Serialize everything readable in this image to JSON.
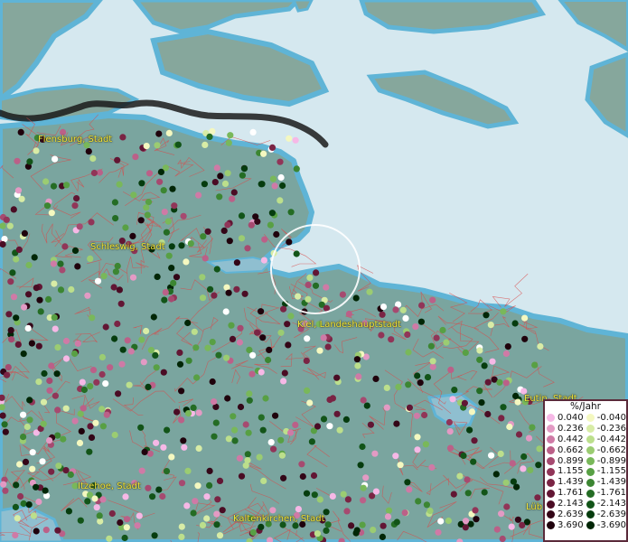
{
  "map": {
    "place_labels": [
      {
        "text": "Flensburg, Stadt"
      },
      {
        "text": "Schleswig, Stadt"
      },
      {
        "text": "Kiel, Landeshauptstadt"
      },
      {
        "text": "Eutin, Stadt"
      },
      {
        "text": "Itzehoe, Stadt"
      },
      {
        "text": "Kaltenkirchen, Stadt"
      },
      {
        "text": "Lüb"
      }
    ]
  },
  "legend": {
    "title": "%/Jahr",
    "positive": [
      {
        "label": "0.040",
        "color": "#f6b8e6"
      },
      {
        "label": "0.236",
        "color": "#e39ac4"
      },
      {
        "label": "0.442",
        "color": "#cf7aa6"
      },
      {
        "label": "0.662",
        "color": "#bb6088"
      },
      {
        "label": "0.899",
        "color": "#a64a70"
      },
      {
        "label": "1.155",
        "color": "#913558"
      },
      {
        "label": "1.439",
        "color": "#7a2444"
      },
      {
        "label": "1.761",
        "color": "#621634"
      },
      {
        "label": "2.143",
        "color": "#4a0c24"
      },
      {
        "label": "2.639",
        "color": "#330617"
      },
      {
        "label": "3.690",
        "color": "#1f020c"
      }
    ],
    "negative": [
      {
        "label": "-0.040",
        "color": "#f4f8c0"
      },
      {
        "label": "-0.236",
        "color": "#d8eca6"
      },
      {
        "label": "-0.442",
        "color": "#bcdf8c"
      },
      {
        "label": "-0.662",
        "color": "#9bcc72"
      },
      {
        "label": "-0.899",
        "color": "#79b85a"
      },
      {
        "label": "-1.155",
        "color": "#58a044"
      },
      {
        "label": "-1.439",
        "color": "#3c8632"
      },
      {
        "label": "-1.761",
        "color": "#246c24"
      },
      {
        "label": "-2.143",
        "color": "#125418"
      },
      {
        "label": "-2.639",
        "color": "#063c0e"
      },
      {
        "label": "-3.690",
        "color": "#012606"
      }
    ]
  },
  "colors": {
    "land": "#7aa59f",
    "sea": "#d5e8ef",
    "coast": "#5fb4d6",
    "boundary": "#d94a4a",
    "border_line": "#1a1a1a",
    "label": "#f2e63a"
  }
}
